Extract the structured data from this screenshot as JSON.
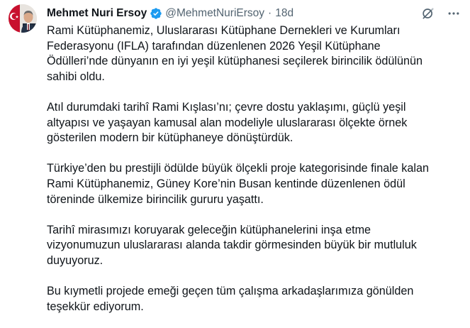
{
  "author": {
    "name": "Mehmet Nuri Ersoy",
    "handle": "@MehmetNuriErsoy",
    "separator": "·",
    "time": "18d",
    "verified": true
  },
  "icons": {
    "verified": "verified-badge-icon",
    "grok": "grok-icon",
    "more": "more-options-icon"
  },
  "colors": {
    "verified_blue": "#1d9bf0",
    "text_primary": "#0f1419",
    "text_secondary": "#536471"
  },
  "post": {
    "paragraphs": [
      {
        "lines": [
          "Rami Kütüphanemiz, Uluslararası Kütüphane Dernekleri ve Kurumları",
          "Federasyonu (IFLA) tarafından düzenlenen 2026 Yeşil Kütüphane",
          "Ödülleri’nde dünyanın en iyi yeşil kütüphanesi seçilerek birincilik ödülünün",
          "sahibi oldu."
        ]
      },
      {
        "lines": [
          "Atıl durumdaki tarihî Rami Kışlası’nı; çevre dostu yaklaşımı, güçlü yeşil",
          "altyapısı ve yaşayan kamusal alan modeliyle uluslararası ölçekte örnek",
          "gösterilen modern bir kütüphaneye dönüştürdük."
        ]
      },
      {
        "lines": [
          "Türkiye’den bu prestijli ödülde büyük ölçekli proje kategorisinde finale kalan",
          "Rami Kütüphanemiz, Güney Kore’nin Busan kentinde düzenlenen ödül",
          "töreninde ülkemize birincilik gururu yaşattı."
        ]
      },
      {
        "lines": [
          "Tarihî mirasımızı koruyarak geleceğin kütüphanelerini inşa etme",
          "vizyonumuzun uluslararası alanda takdir görmesinden büyük bir mutluluk",
          "duyuyoruz."
        ]
      },
      {
        "lines": [
          "Bu kıymetli projede emeği geçen tüm çalışma arkadaşlarımıza gönülden",
          "teşekkür ediyorum."
        ]
      }
    ]
  }
}
